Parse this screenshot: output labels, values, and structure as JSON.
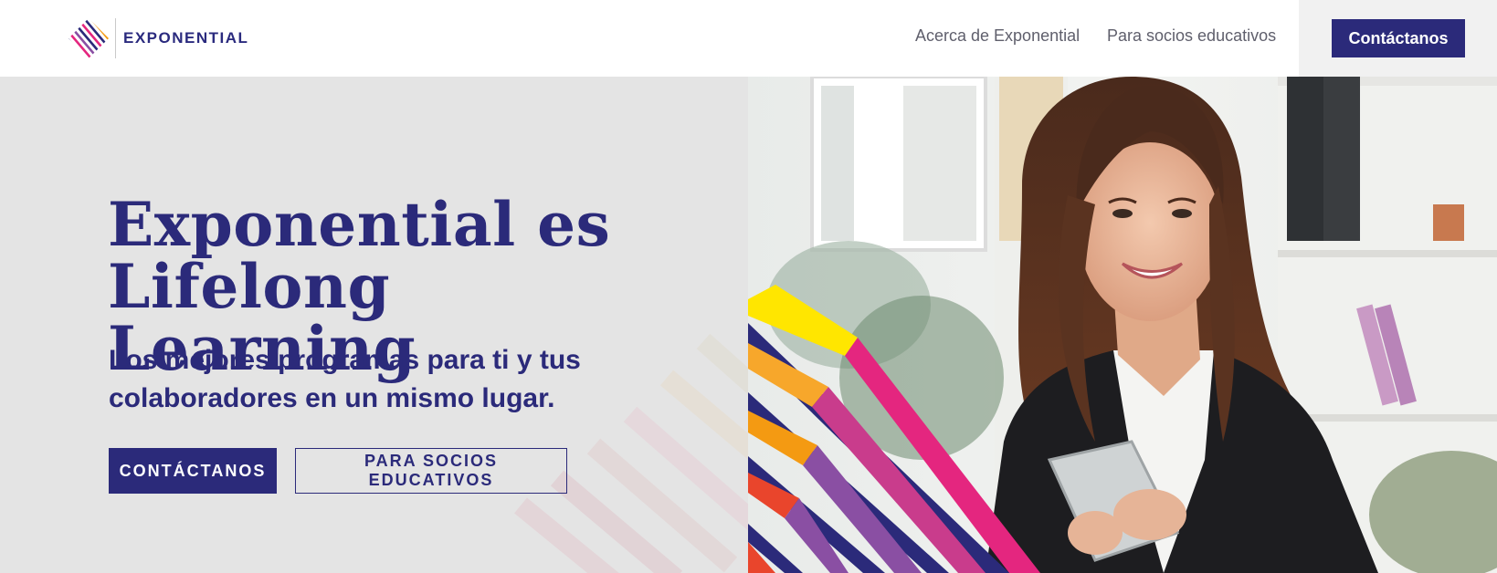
{
  "brand": {
    "name": "EXPONENTIAL",
    "logo_icon": "exponential-stripes-logo"
  },
  "nav": {
    "items": [
      {
        "label": "Acerca de Exponential"
      },
      {
        "label": "Para socios educativos"
      }
    ],
    "cta_label": "Contáctanos"
  },
  "hero": {
    "title": "Exponential es Lifelong Learning",
    "subtitle": "Los mejores programas para ti y tus colaboradores en un mismo lugar.",
    "primary_button": "CONTÁCTANOS",
    "secondary_button": "PARA SOCIOS EDUCATIVOS"
  },
  "colors": {
    "brand_navy": "#2b2a7a",
    "hero_bg": "#e4e4e4",
    "accent_yellow": "#ffe600",
    "accent_pink": "#e4267f",
    "accent_orange": "#f49a12",
    "accent_purple": "#8a4fa3",
    "accent_red": "#e9452c"
  }
}
